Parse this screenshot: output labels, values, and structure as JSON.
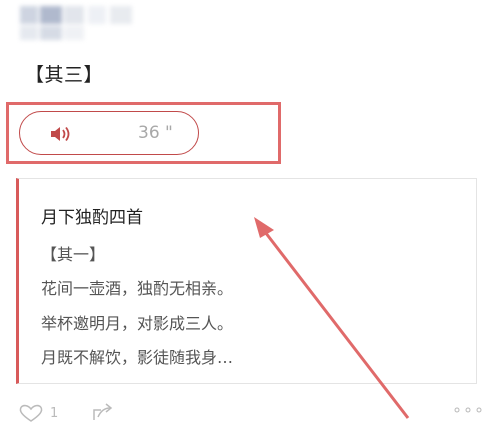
{
  "colors": {
    "accent_red": "#c14a4a",
    "highlight_red": "#e06a6a",
    "card_border_left": "#d85a5a"
  },
  "post": {
    "section_heading": "【其三】",
    "audio": {
      "duration": "36 \"",
      "icon": "speaker-icon"
    }
  },
  "card": {
    "title": "月下独酌四首",
    "lines": [
      "【其一】",
      "花间一壶酒，独酌无相亲。",
      "举杯邀明月，对影成三人。",
      "月既不解饮，影徒随我身…"
    ]
  },
  "footer": {
    "like_count": "1",
    "more": "∘∘∘",
    "icons": [
      "heart-icon",
      "share-icon",
      "more-icon"
    ]
  }
}
